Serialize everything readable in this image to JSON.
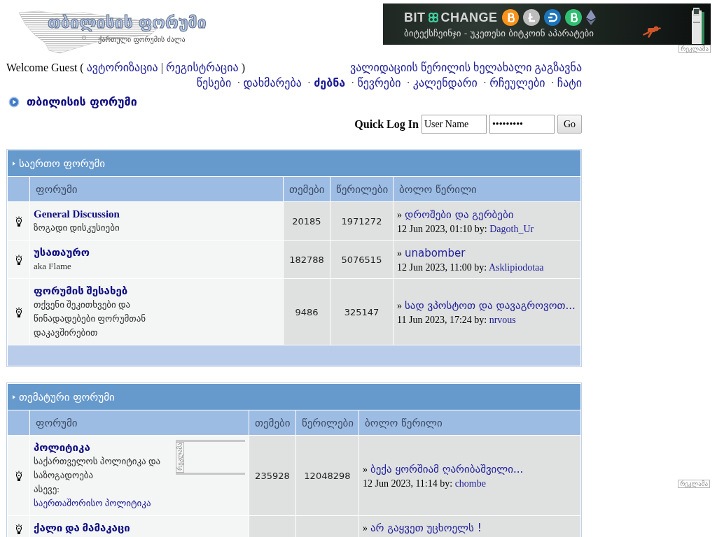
{
  "logo": {
    "title": "თბილისის ფორუმი",
    "subtitle": "ქართული ფორუმის ძალა"
  },
  "banner": {
    "brand_left": "BIT",
    "brand_right": "CHANGE",
    "tagline": "ბიტექსჩეინჯი - უკეთესი ბიტკოინ აპარატები",
    "ad_label": "რეკლამა"
  },
  "user_bar": {
    "greeting": "Welcome Guest (",
    "login_link": "ავტორიზაცია",
    "divider": "|",
    "register_link": "რეგისტრაცია",
    "closing": ")",
    "resend_link": "ვალიდაციის წერილის ხელახალი გაგზავნა"
  },
  "nav": [
    {
      "label": "წესები",
      "selected": false
    },
    {
      "separator": "·",
      "label": "დახმარება",
      "selected": false
    },
    {
      "separator": "·",
      "label": "ძებნა",
      "selected": true
    },
    {
      "separator": "·",
      "label": "წევრები",
      "selected": false
    },
    {
      "separator": "·",
      "label": "კალენდარი",
      "selected": false
    },
    {
      "separator": "·",
      "label": "რჩეულები",
      "selected": false
    },
    {
      "separator": "·",
      "label": "ჩატი",
      "selected": false
    }
  ],
  "breadcrumb": {
    "label": "თბილისის ფორუმი"
  },
  "quick_login": {
    "label": "Quick Log In",
    "username": "User Name",
    "password": "•••••••••",
    "button": "Go"
  },
  "categories": [
    {
      "title": "საერთო ფორუმი",
      "columns": [
        "ფორუმი",
        "თემები",
        "წერილები",
        "ბოლო წერილი"
      ],
      "forums": [
        {
          "name": "General Discussion",
          "description": "ზოგადი დისკუსიები",
          "topics": "20185",
          "posts": "1971272",
          "last_post": {
            "marker": "»",
            "title": "დროშები და გერბები",
            "date": "12 Jun 2023, 01:10 by:",
            "author": "Dagoth_Ur"
          }
        },
        {
          "name": "უსათაურო",
          "description": "aka Flame",
          "topics": "182788",
          "posts": "5076515",
          "last_post": {
            "marker": "»",
            "title": "unabomber",
            "date": "12 Jun 2023, 11:00 by:",
            "author": "Asklipiodotaa"
          }
        },
        {
          "name": "ფორუმის შესახებ",
          "description": "თქვენი შეკითხვები და წინადადებები ფორუმთან დაკავშირებით",
          "topics": "9486",
          "posts": "325147",
          "last_post": {
            "marker": "»",
            "title": "სად ვპოსტოთ და დავაგროვოთ...",
            "date": "11 Jun 2023, 17:24 by:",
            "author": "nrvous"
          }
        }
      ]
    },
    {
      "title": "თემატური ფორუმი",
      "columns": [
        "ფორუმი",
        "თემები",
        "წერილები",
        "ბოლო წერილი"
      ],
      "forums": [
        {
          "name": "პოლიტიკა",
          "description": "საქართველოს პოლიტიკა და საზოგადოება",
          "also": {
            "label": "ასევე:",
            "link": "საერთაშორისო პოლიტიკა"
          },
          "ad": {
            "label": "რეკლამა"
          },
          "topics": "235928",
          "posts": "12048298",
          "last_post": {
            "marker": "»",
            "title": "ბექა ყორშიამ ღარიბაშვილი...",
            "date": "12 Jun 2023, 11:14 by:",
            "author": "chombe"
          }
        },
        {
          "name": "ქალი და მამაკაცი",
          "last_post": {
            "marker": "»",
            "title": "არ გაყვეთ უცხოელს !"
          }
        }
      ]
    }
  ],
  "side_ad": {
    "label": "რეკლამა"
  }
}
